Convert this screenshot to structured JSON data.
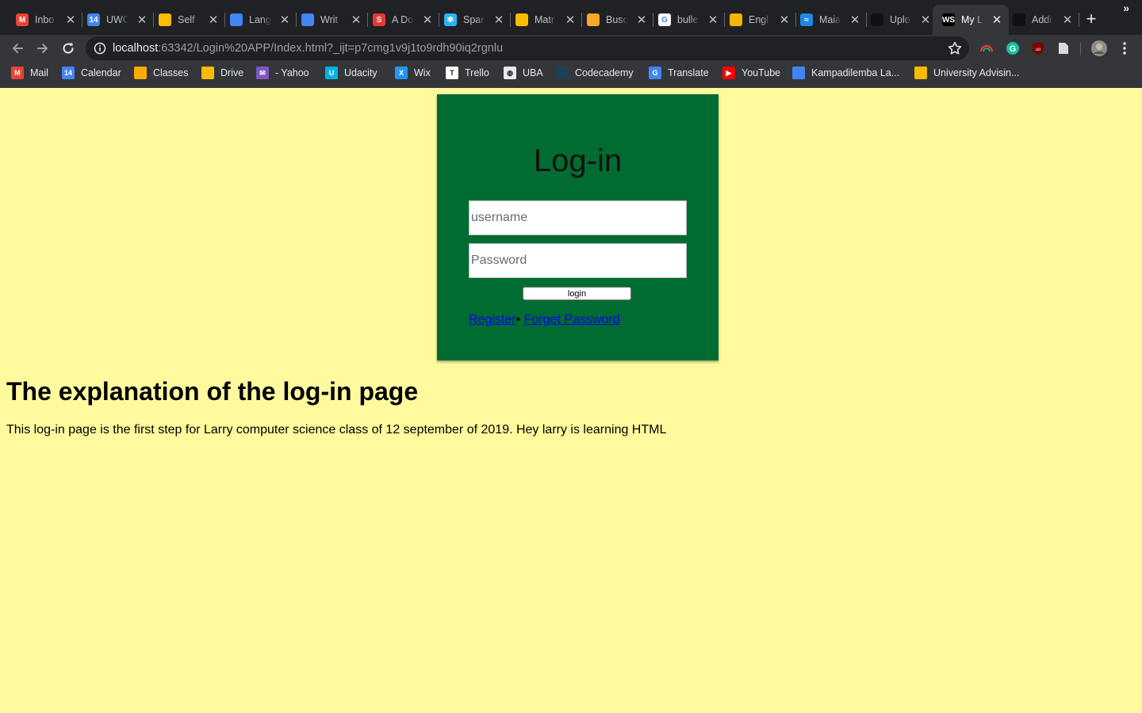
{
  "browser": {
    "tabs": [
      {
        "label": "Inbo",
        "icon": "gmail-icon",
        "color": "#ea4335",
        "glyph": "M"
      },
      {
        "label": "UWC",
        "icon": "calendar-icon",
        "color": "#4285f4",
        "glyph": "14"
      },
      {
        "label": "Self",
        "icon": "drive-icon",
        "color": "#fbbc04",
        "glyph": ""
      },
      {
        "label": "Lang",
        "icon": "docs-icon",
        "color": "#4285f4",
        "glyph": ""
      },
      {
        "label": "Writ",
        "icon": "docs-icon",
        "color": "#4285f4",
        "glyph": ""
      },
      {
        "label": "A Do",
        "icon": "s-logo-icon",
        "color": "#e53935",
        "glyph": "S"
      },
      {
        "label": "Spar",
        "icon": "snowflake-icon",
        "color": "#29b6f6",
        "glyph": "✻"
      },
      {
        "label": "Matr",
        "icon": "drive-icon",
        "color": "#fbbc04",
        "glyph": ""
      },
      {
        "label": "Busc",
        "icon": "tag-icon",
        "color": "#f9a825",
        "glyph": ""
      },
      {
        "label": "bulle",
        "icon": "google-icon",
        "color": "#ffffff",
        "glyph": "G"
      },
      {
        "label": "Engl",
        "icon": "slides-icon",
        "color": "#f4b400",
        "glyph": ""
      },
      {
        "label": "Maia",
        "icon": "maia-icon",
        "color": "#1e88e5",
        "glyph": "≈"
      },
      {
        "label": "Uplo",
        "icon": "github-icon",
        "color": "#111111",
        "glyph": ""
      },
      {
        "label": "My L",
        "icon": "webstorm-icon",
        "color": "#000000",
        "glyph": "WS"
      },
      {
        "label": "Addi",
        "icon": "github-icon",
        "color": "#111111",
        "glyph": ""
      }
    ],
    "active_tab": 13,
    "new_tab": "+",
    "close_glyph": "✕",
    "url_host": "localhost",
    "url_rest": ":63342/Login%20APP/Index.html?_ijt=p7cmg1v9j1to9rdh90iq2rgnlu",
    "bookmarks": [
      {
        "label": "Mail",
        "icon": "gmail-icon",
        "color": "#ea4335",
        "glyph": "M"
      },
      {
        "label": "Calendar",
        "icon": "calendar-icon",
        "color": "#4285f4",
        "glyph": "14"
      },
      {
        "label": "Classes",
        "icon": "classroom-icon",
        "color": "#f9ab00",
        "glyph": ""
      },
      {
        "label": "Drive",
        "icon": "drive-icon",
        "color": "#fbbc04",
        "glyph": ""
      },
      {
        "label": "- Yahoo",
        "icon": "yahoo-mail-icon",
        "color": "#7e57c2",
        "glyph": "✉"
      },
      {
        "label": "Udacity",
        "icon": "udacity-icon",
        "color": "#02b3e4",
        "glyph": "U"
      },
      {
        "label": "Wix",
        "icon": "wix-icon",
        "color": "#2196f3",
        "glyph": "X"
      },
      {
        "label": "Trello",
        "icon": "trello-icon",
        "color": "#ffffff",
        "glyph": "T"
      },
      {
        "label": "UBA",
        "icon": "globe-icon",
        "color": "#e8eaed",
        "glyph": "◍"
      },
      {
        "label": "Codecademy",
        "icon": "codecademy-icon",
        "color": "#1f4056",
        "glyph": ""
      },
      {
        "label": "Translate",
        "icon": "translate-icon",
        "color": "#4285f4",
        "glyph": "G"
      },
      {
        "label": "YouTube",
        "icon": "youtube-icon",
        "color": "#ff0000",
        "glyph": "▶"
      },
      {
        "label": "Kampadilemba La...",
        "icon": "docs-icon",
        "color": "#4285f4",
        "glyph": ""
      },
      {
        "label": "University Advisin...",
        "icon": "drive-icon",
        "color": "#fbbc04",
        "glyph": ""
      }
    ],
    "bookmarks_more": "»"
  },
  "page": {
    "login_title": "Log-in",
    "username_placeholder": "username",
    "password_placeholder": "Password",
    "login_button": "login",
    "register_link": "Register",
    "separator": "•",
    "forget_link": "Forget Password",
    "heading": "The explanation of the log-in page",
    "paragraph": "This log-in page is the first step for Larry computer science class of 12 september of 2019. Hey larry is learning HTML"
  },
  "colors": {
    "page_background": "#fffa9e",
    "login_box": "#006c32",
    "link": "#0000ee"
  }
}
